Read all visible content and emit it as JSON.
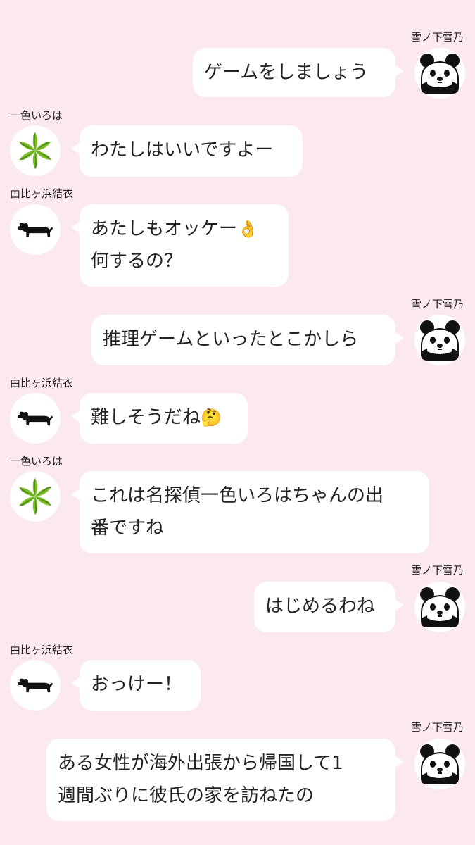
{
  "colors": {
    "background": "#fce9ee",
    "bubble": "#ffffff",
    "leaf": "#7cbf2a"
  },
  "participants": {
    "yukino": {
      "name": "雪ノ下雪乃",
      "avatar_icon": "panda-icon"
    },
    "iroha": {
      "name": "一色いろは",
      "avatar_icon": "green-leaf-star-icon"
    },
    "yui": {
      "name": "由比ヶ浜結衣",
      "avatar_icon": "dachshund-icon"
    }
  },
  "messages": [
    {
      "sender": "雪ノ下雪乃",
      "lines": [
        "ゲームをしましょう"
      ]
    },
    {
      "sender": "一色いろは",
      "lines": [
        "わたしはいいですよー"
      ]
    },
    {
      "sender": "由比ヶ浜結衣",
      "lines": [
        "あたしもオッケー",
        "何するの？"
      ],
      "emoji": "👌",
      "emoji_icon": "ok-hand-emoji"
    },
    {
      "sender": "雪ノ下雪乃",
      "lines": [
        "推理ゲームといったとこかしら"
      ]
    },
    {
      "sender": "由比ヶ浜結衣",
      "lines": [
        "難しそうだね"
      ],
      "emoji": "🤔",
      "emoji_icon": "thinking-face-emoji"
    },
    {
      "sender": "一色いろは",
      "lines": [
        "これは名探偵一色いろはちゃんの出",
        "番ですね"
      ]
    },
    {
      "sender": "雪ノ下雪乃",
      "lines": [
        "はじめるわね"
      ]
    },
    {
      "sender": "由比ヶ浜結衣",
      "lines": [
        "おっけー！"
      ]
    },
    {
      "sender": "雪ノ下雪乃",
      "lines": [
        "ある女性が海外出張から帰国して1",
        "週間ぶりに彼氏の家を訪ねたの"
      ]
    }
  ]
}
